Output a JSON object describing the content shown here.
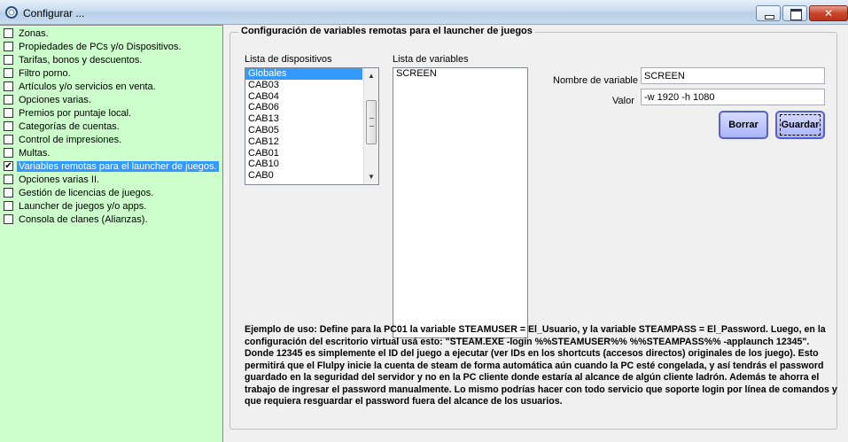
{
  "window": {
    "title": "Configurar ..."
  },
  "tree": {
    "items": [
      {
        "label": "Zonas.",
        "checked": false
      },
      {
        "label": "Propiedades de PCs y/o Dispositivos.",
        "checked": false
      },
      {
        "label": "Tarifas, bonos y descuentos.",
        "checked": false
      },
      {
        "label": "Filtro porno.",
        "checked": false
      },
      {
        "label": "Artículos y/o servicios en venta.",
        "checked": false
      },
      {
        "label": "Opciones varias.",
        "checked": false
      },
      {
        "label": "Premios por puntaje local.",
        "checked": false
      },
      {
        "label": "Categorías de cuentas.",
        "checked": false
      },
      {
        "label": "Control de impresiones.",
        "checked": false
      },
      {
        "label": "Multas.",
        "checked": false
      },
      {
        "label": "Variables remotas para el launcher de juegos.",
        "checked": true,
        "selected": true
      },
      {
        "label": "Opciones varias II.",
        "checked": false
      },
      {
        "label": "Gestión de licencias de juegos.",
        "checked": false
      },
      {
        "label": "Launcher de juegos y/o apps.",
        "checked": false
      },
      {
        "label": "Consola de clanes (Alianzas).",
        "checked": false
      }
    ],
    "check_mark": "✔"
  },
  "main": {
    "group_title": "Configuración de variables remotas para el launcher de juegos",
    "devices_label": "Lista de dispositivos",
    "devices": [
      "Globales",
      "CAB03",
      "CAB04",
      "CAB06",
      "CAB13",
      "CAB05",
      "CAB12",
      "CAB01",
      "CAB10",
      "CAB0"
    ],
    "variables_label": "Lista de variables",
    "variables": [
      "SCREEN"
    ],
    "var_name_label": "Nombre de variable",
    "var_name_value": "SCREEN",
    "value_label": "Valor",
    "value_value": "-w 1920 -h 1080",
    "delete_button": "Borrar",
    "save_button": "Guardar",
    "help_text": "Ejemplo de uso: Define para la PC01 la variable STEAMUSER = El_Usuario, y la variable STEAMPASS = El_Password. Luego, en la configuración del escritorio virtual usá esto: \"STEAM.EXE -login %%STEAMUSER%% %%STEAMPASS%% -applaunch 12345\". Donde 12345 es simplemente el ID del juego a ejecutar (ver IDs en los shortcuts (accesos directos) originales de los juego). Esto permitirá que el Flulpy inicie la cuenta de steam de forma automática aún cuando la PC esté congelada, y así tendrás el password guardado en la seguridad del servidor y no en la PC cliente donde estaría al alcance de algún cliente ladrón. Además te ahorra el trabajo de ingresar el password manualmente. Lo mismo podrías hacer con todo servicio que soporte login por línea de comandos y que requiera resguardar el password fuera del alcance de los usuarios."
  },
  "icons": {
    "app": "gear-icon",
    "scroll_up": "▲",
    "scroll_down": "▼"
  },
  "colors": {
    "tree_bg": "#ccffcc",
    "selection": "#3399ff",
    "button_border": "#5a5fd0"
  }
}
